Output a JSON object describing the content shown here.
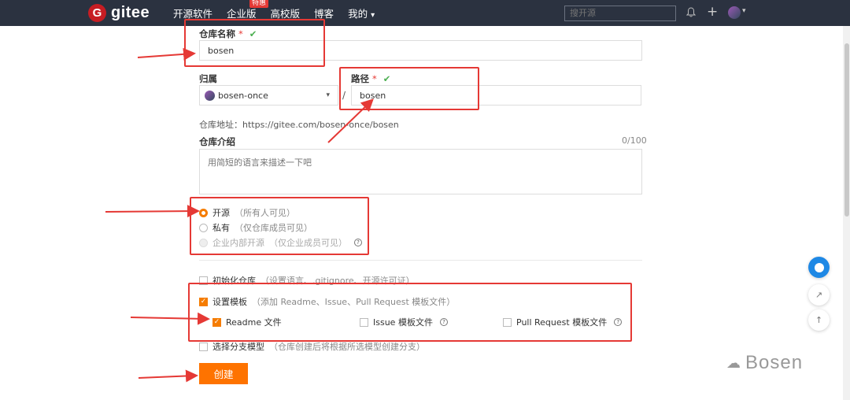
{
  "nav": {
    "brand": "gitee",
    "brand_badge": "G",
    "links": [
      "开源软件",
      "企业版",
      "高校版",
      "博客",
      "我的"
    ],
    "hot_badge": "特惠",
    "dropdown_caret": "▾",
    "search_placeholder": "搜开源"
  },
  "form": {
    "repo_name_label": "仓库名称",
    "required_mark": "*",
    "check_mark": "✔",
    "repo_name_value": "bosen",
    "owner_label": "归属",
    "owner_value": "bosen-once",
    "path_label": "路径",
    "path_sep": "/",
    "path_value": "bosen",
    "repo_url_text": "仓库地址：https://gitee.com/bosen-once/bosen",
    "desc_label": "仓库介绍",
    "desc_counter": "0/100",
    "desc_placeholder": "用简短的语言来描述一下吧",
    "visibility": [
      {
        "label": "开源",
        "note": "（所有人可见）",
        "state": "selected"
      },
      {
        "label": "私有",
        "note": "（仅仓库成员可见）",
        "state": "unselected"
      },
      {
        "label": "企业内部开源",
        "note": "（仅企业成员可见）",
        "state": "disabled"
      }
    ],
    "init_repo_label": "初始化仓库",
    "init_repo_note": "（设置语言、.gitignore、开源许可证）",
    "template_label": "设置模板",
    "template_note": "（添加 Readme、Issue、Pull Request 模板文件）",
    "template_files": [
      {
        "label": "Readme 文件",
        "checked": true
      },
      {
        "label": "Issue 模板文件",
        "checked": false
      },
      {
        "label": "Pull Request 模板文件",
        "checked": false
      }
    ],
    "branch_label": "选择分支模型",
    "branch_note": "（仓库创建后将根据所选模型创建分支）",
    "submit_label": "创建"
  },
  "watermark": "Bosen",
  "colors": {
    "accent": "#fe7300",
    "annotation": "#e53935",
    "nav_bg": "#2b3240"
  }
}
